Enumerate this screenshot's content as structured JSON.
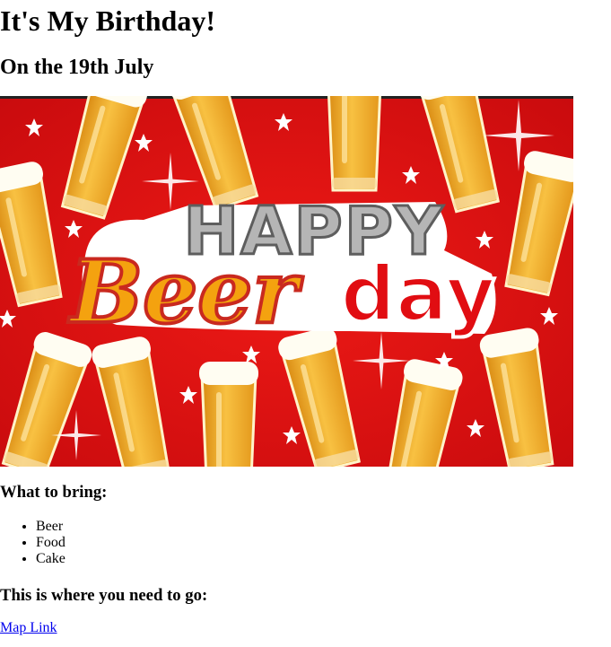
{
  "page": {
    "title": "It's My Birthday!",
    "subtitle": "On the 19th July"
  },
  "banner": {
    "line1": "HAPPY",
    "line2a": "Beer",
    "line2b": "day",
    "colors": {
      "background": "#e10d12",
      "beer": "#f2a81c",
      "foam": "#fffef4",
      "text_orange": "#f7a70f",
      "text_silver": "#b7b7b7"
    }
  },
  "bring": {
    "heading": "What to bring:",
    "items": [
      "Beer",
      "Food",
      "Cake"
    ]
  },
  "directions": {
    "heading": "This is where you need to go:",
    "link_text": "Map Link"
  }
}
